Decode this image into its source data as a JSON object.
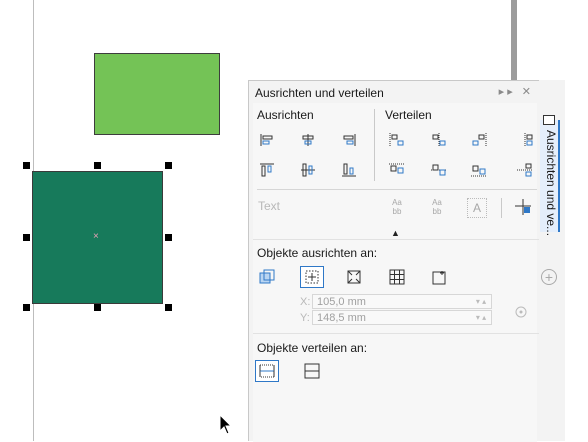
{
  "docker": {
    "title": "Ausrichten und verteilen",
    "ctrl_arrows": "▸▸",
    "ctrl_close": "✕",
    "align_label": "Ausrichten",
    "distribute_label": "Verteilen",
    "text_label": "Text",
    "align_to_label": "Objekte ausrichten an:",
    "distribute_to_label": "Objekte verteilen an:",
    "x_label": "X:",
    "y_label": "Y:",
    "x_value": "105,0 mm",
    "y_value": "148,5 mm",
    "collapse_glyph": "▲"
  },
  "side_tab": {
    "label": "Ausrichten und ve..."
  },
  "text_icon_glyphs": {
    "a": "Aa\nbb",
    "b": "Aa\nbb",
    "c": "A"
  },
  "colors": {
    "accent": "#2f78c7",
    "light_rect": "#74c356",
    "dark_rect": "#177a5b"
  }
}
